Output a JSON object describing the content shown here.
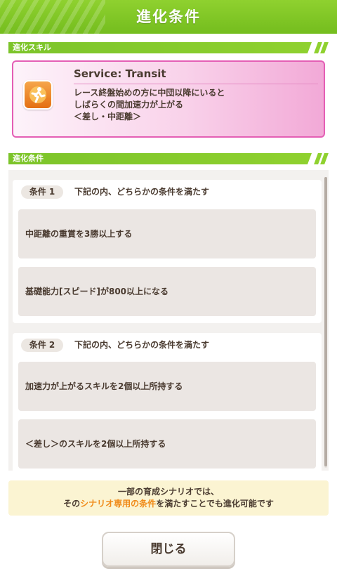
{
  "dialog": {
    "title": "進化条件"
  },
  "sections": {
    "skill_label": "進化スキル",
    "conditions_label": "進化条件"
  },
  "skill": {
    "name": "Service: Transit",
    "icon": "speed-skill-icon",
    "description_lines": [
      "レース終盤始めの方に中団以降にいると",
      "しばらくの間加速力が上がる",
      "＜差し・中距離＞"
    ]
  },
  "conditions": [
    {
      "tag": "条件 1",
      "heading": "下記の内、どちらかの条件を満たす",
      "items": [
        "中距離の重賞を3勝以上する",
        "基礎能力[スピード]が800以上になる"
      ]
    },
    {
      "tag": "条件 2",
      "heading": "下記の内、どちらかの条件を満たす",
      "items": [
        "加速力が上がるスキルを2個以上所持する",
        "＜差し＞のスキルを2個以上所持する"
      ]
    }
  ],
  "notice": {
    "line1": "一部の育成シナリオでは、",
    "line2_pre": "その",
    "line2_highlight": "シナリオ専用の条件",
    "line2_post": "を満たすことでも進化可能です"
  },
  "close_label": "閉じる",
  "colors": {
    "accent_green": "#7cc42a",
    "skill_border": "#e45fb5",
    "highlight_orange": "#f08a18"
  }
}
